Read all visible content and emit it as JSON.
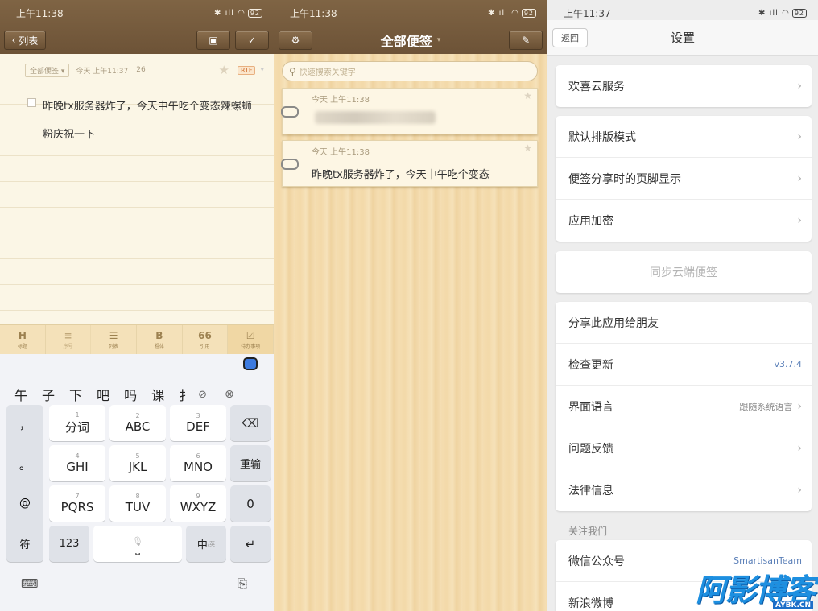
{
  "left_panel": {
    "status_time": "上午11:38",
    "status_battery": "92",
    "back_label": "列表",
    "note_chip": "全部便签",
    "note_time": "今天 上午11:37",
    "note_count": "26",
    "rtf_label": "RTF",
    "note_line_1": "昨晚tx服务器炸了，今天中午吃个变态辣螺蛳",
    "note_line_2": "粉庆祝一下",
    "toolbar": [
      {
        "glyph": "H",
        "label": "标题"
      },
      {
        "glyph": "≡",
        "label": "序号"
      },
      {
        "glyph": "☰",
        "label": "列表"
      },
      {
        "glyph": "B",
        "label": "粗体"
      },
      {
        "glyph": "66",
        "label": "引用"
      },
      {
        "glyph": "☑",
        "label": "待办事项"
      }
    ],
    "candidates": [
      "午",
      "子",
      "下",
      "吧",
      "吗",
      "课",
      "扌"
    ],
    "side_keys": [
      "，",
      "。",
      "@",
      "？"
    ],
    "keys": [
      {
        "n": "1",
        "t": "分词"
      },
      {
        "n": "2",
        "t": "ABC"
      },
      {
        "n": "3",
        "t": "DEF"
      },
      {
        "n": "4",
        "t": "GHI"
      },
      {
        "n": "5",
        "t": "JKL"
      },
      {
        "n": "6",
        "t": "MNO"
      },
      {
        "n": "7",
        "t": "PQRS"
      },
      {
        "n": "8",
        "t": "TUV"
      },
      {
        "n": "9",
        "t": "WXYZ"
      }
    ],
    "reenter": "重输",
    "zero": "0",
    "fu": "符",
    "num": "123",
    "zh": "中",
    "zh_sub": "/英"
  },
  "middle_panel": {
    "status_time": "上午11:38",
    "status_battery": "92",
    "title": "全部便签",
    "search_placeholder": "快速搜索关键字",
    "notes": [
      {
        "time": "今天 上午11:38",
        "body": ""
      },
      {
        "time": "今天 上午11:38",
        "body": "昨晚tx服务器炸了，今天中午吃个变态"
      }
    ]
  },
  "right_panel": {
    "status_time": "上午11:37",
    "status_battery": "92",
    "back_label": "返回",
    "title": "设置",
    "cloud": "欢喜云服务",
    "layout": "默认排版模式",
    "footer": "便签分享时的页脚显示",
    "encrypt": "应用加密",
    "sync": "同步云端便签",
    "share": "分享此应用给朋友",
    "update": "检查更新",
    "version": "v3.7.4",
    "language": "界面语言",
    "language_value": "跟随系统语言",
    "feedback": "问题反馈",
    "legal": "法律信息",
    "follow_section": "关注我们",
    "wechat": "微信公众号",
    "wechat_value": "SmartisanTeam",
    "weibo": "新浪微博"
  },
  "watermark": "阿影博客",
  "watermark_sub": "AYBK.CN"
}
